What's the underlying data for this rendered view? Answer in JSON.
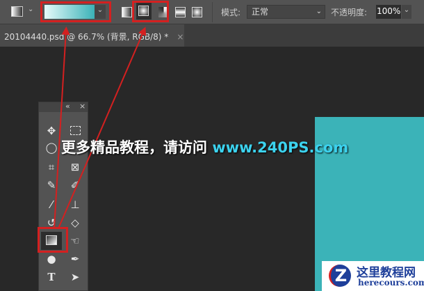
{
  "toolbar": {
    "mode_label": "模式:",
    "mode_value": "正常",
    "opacity_label": "不透明度:",
    "opacity_value": "100%",
    "gradient_start": "#e6fafa",
    "gradient_end": "#3bb3b8"
  },
  "tab": {
    "title": "20104440.psd @ 66.7% (背景, RGB/8) *",
    "close": "×"
  },
  "panel": {
    "collapse": "«",
    "close": "×"
  },
  "watermark": {
    "text": "更多精品教程，请访问 ",
    "url": "www.240PS.com"
  },
  "logo": {
    "title": "这里教程网",
    "domain": "herecours.com",
    "letter": "Z"
  },
  "colors": {
    "canvas": "#3bb3b8",
    "highlight": "#d42020"
  }
}
